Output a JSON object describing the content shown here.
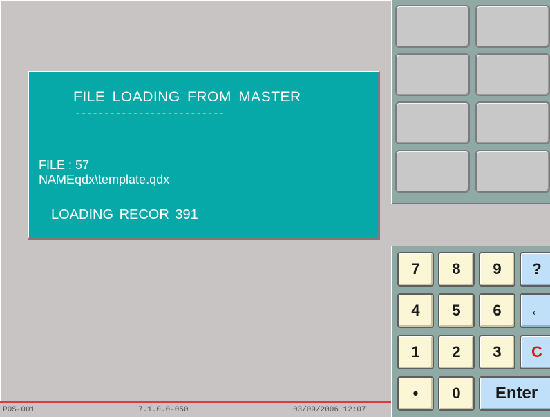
{
  "dialog": {
    "title": "FILE LOADING FROM MASTER",
    "separator": "--------------------------",
    "file_line": "FILE  :  57",
    "name_line": "NAMEqdx\\template.qdx",
    "loading_line": "LOADING RECOR 391"
  },
  "status_bar": {
    "terminal": "POS-001",
    "version": "7.1.0.0-050",
    "datetime": "03/09/2006 12:07"
  },
  "function_keys": [
    "",
    "",
    "",
    "",
    "",
    "",
    "",
    ""
  ],
  "keypad": {
    "rows": [
      [
        {
          "label": "7",
          "style": "num"
        },
        {
          "label": "8",
          "style": "num"
        },
        {
          "label": "9",
          "style": "num"
        },
        {
          "label": "?",
          "style": "blue"
        }
      ],
      [
        {
          "label": "4",
          "style": "num"
        },
        {
          "label": "5",
          "style": "num"
        },
        {
          "label": "6",
          "style": "num"
        },
        {
          "label": "←",
          "style": "blue"
        }
      ],
      [
        {
          "label": "1",
          "style": "num"
        },
        {
          "label": "2",
          "style": "num"
        },
        {
          "label": "3",
          "style": "num"
        },
        {
          "label": "C",
          "style": "blue-red"
        }
      ],
      [
        {
          "label": "•",
          "style": "num"
        },
        {
          "label": "0",
          "style": "num"
        },
        {
          "label": "Enter",
          "style": "blue"
        }
      ]
    ]
  },
  "colors": {
    "dialog_bg": "#07a8a8",
    "panel_bg": "#8fa9a5",
    "key_num": "#fbf6d6",
    "key_blue": "#bfe0f8",
    "clear_red": "#e01818"
  }
}
